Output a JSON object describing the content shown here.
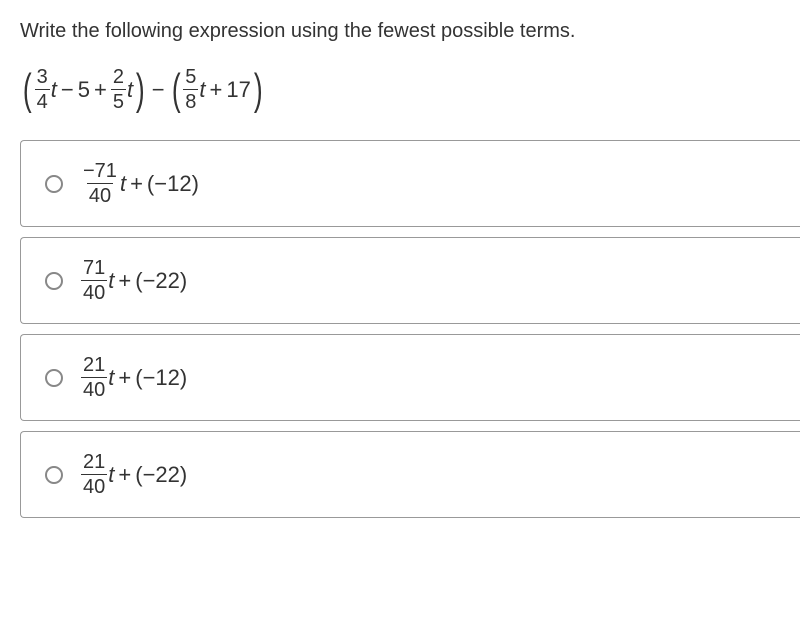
{
  "prompt": "Write the following expression using the fewest possible terms.",
  "expression": {
    "p1": {
      "f1_num": "3",
      "f1_den": "4",
      "t1_var": "t",
      "op1": "−",
      "c1": "5",
      "op2": "+",
      "f2_num": "2",
      "f2_den": "5",
      "t2_var": "t"
    },
    "op_mid": "−",
    "p2": {
      "f1_num": "5",
      "f1_den": "8",
      "t1_var": "t",
      "op1": "+",
      "c1": "17"
    }
  },
  "options": [
    {
      "frac_num": "−71",
      "frac_den": "40",
      "var": "t",
      "op": "+",
      "paren_neg": "−12"
    },
    {
      "frac_num": "71",
      "frac_den": "40",
      "var": "t",
      "op": "+",
      "paren_neg": "−22"
    },
    {
      "frac_num": "21",
      "frac_den": "40",
      "var": "t",
      "op": "+",
      "paren_neg": "−12"
    },
    {
      "frac_num": "21",
      "frac_den": "40",
      "var": "t",
      "op": "+",
      "paren_neg": "−22"
    }
  ]
}
